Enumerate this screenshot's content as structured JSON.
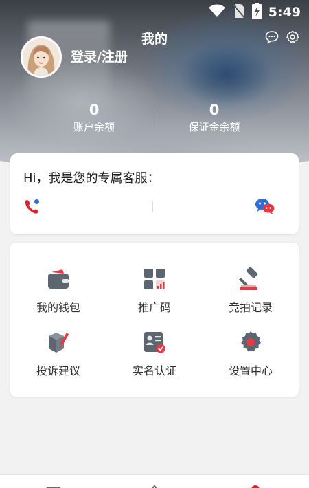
{
  "status_bar": {
    "time": "5:49"
  },
  "header": {
    "title": "我的"
  },
  "profile": {
    "login_text": "登录/注册"
  },
  "stats": [
    {
      "value": "0",
      "label": "账户余额"
    },
    {
      "value": "0",
      "label": "保证金余额"
    }
  ],
  "service": {
    "title": "Hi，我是您的专属客服："
  },
  "menu": [
    {
      "label": "我的钱包",
      "icon": "wallet-icon"
    },
    {
      "label": "推广码",
      "icon": "promo-code-icon"
    },
    {
      "label": "竞拍记录",
      "icon": "auction-hammer-icon"
    },
    {
      "label": "投诉建议",
      "icon": "complaint-box-icon"
    },
    {
      "label": "实名认证",
      "icon": "id-card-icon"
    },
    {
      "label": "设置中心",
      "icon": "settings-gear-icon"
    }
  ],
  "colors": {
    "accent_red": "#e53946",
    "icon_gray": "#5c6670",
    "brand_blue": "#2d6fd6"
  }
}
